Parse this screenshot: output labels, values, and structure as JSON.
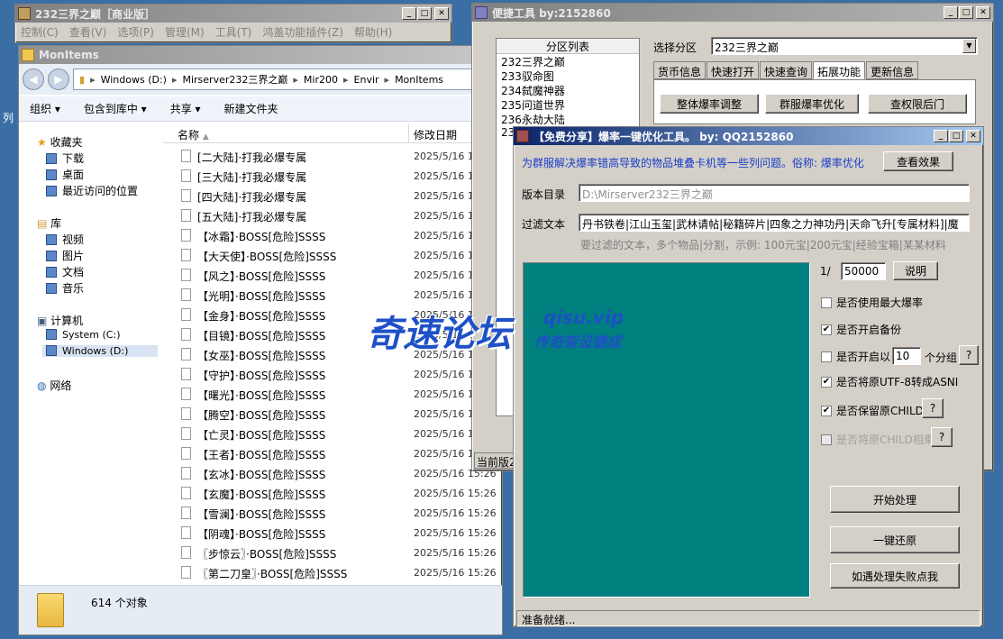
{
  "colors": {
    "desktop": "#3a6ea5",
    "teal": "#007f7f",
    "blue_text": "#1a3dc8"
  },
  "window1": {
    "title": "232三界之巅［商业版］",
    "menu": [
      "控制(C)",
      "查看(V)",
      "选项(P)",
      "管理(M)",
      "工具(T)",
      "鸿盖功能插件(Z)",
      "帮助(H)"
    ]
  },
  "explorer": {
    "title": "MonItems",
    "address": [
      "Windows (D:)",
      "Mirserver232三界之巅",
      "Mir200",
      "Envir",
      "MonItems"
    ],
    "toolbar": [
      "组织 ▾",
      "包含到库中 ▾",
      "共享 ▾",
      "新建文件夹"
    ],
    "nav": {
      "favorites": "收藏夹",
      "fav_items": [
        "下载",
        "桌面",
        "最近访问的位置"
      ],
      "libraries": "库",
      "lib_items": [
        "视频",
        "图片",
        "文档",
        "音乐"
      ],
      "computer": "计算机",
      "drives": [
        "System (C:)",
        "Windows (D:)"
      ],
      "network": "网络"
    },
    "columns": {
      "name": "名称",
      "date": "修改日期"
    },
    "files": [
      {
        "name": "[二大陆]·打我必爆专属",
        "date": "2025/5/16 1"
      },
      {
        "name": "[三大陆]·打我必爆专属",
        "date": "2025/5/16 1"
      },
      {
        "name": "[四大陆]·打我必爆专属",
        "date": "2025/5/16 1"
      },
      {
        "name": "[五大陆]·打我必爆专属",
        "date": "2025/5/16 1"
      },
      {
        "name": "【冰霜】·BOSS[危险]SSSS",
        "date": "2025/5/16 1"
      },
      {
        "name": "【大天使】·BOSS[危险]SSSS",
        "date": "2025/5/16 1"
      },
      {
        "name": "【风之】·BOSS[危险]SSSS",
        "date": "2025/5/16 1"
      },
      {
        "name": "【光明】·BOSS[危险]SSSS",
        "date": "2025/5/16 1"
      },
      {
        "name": "【金身】·BOSS[危险]SSSS",
        "date": "2025/5/16 1"
      },
      {
        "name": "【目镜】·BOSS[危险]SSSS",
        "date": "2025/5/16 1"
      },
      {
        "name": "【女巫】·BOSS[危险]SSSS",
        "date": "2025/5/16 1"
      },
      {
        "name": "【守护】·BOSS[危险]SSSS",
        "date": "2025/5/16 1"
      },
      {
        "name": "【曙光】·BOSS[危险]SSSS",
        "date": "2025/5/16 1"
      },
      {
        "name": "【腾空】·BOSS[危险]SSSS",
        "date": "2025/5/16 1"
      },
      {
        "name": "【亡灵】·BOSS[危险]SSSS",
        "date": "2025/5/16 1"
      },
      {
        "name": "【王者】·BOSS[危险]SSSS",
        "date": "2025/5/16 1"
      },
      {
        "name": "【玄冰】·BOSS[危险]SSSS",
        "date": "2025/5/16 15:26"
      },
      {
        "name": "【玄魔】·BOSS[危险]SSSS",
        "date": "2025/5/16 15:26"
      },
      {
        "name": "【雪澜】·BOSS[危险]SSSS",
        "date": "2025/5/16 15:26"
      },
      {
        "name": "【阴魂】·BOSS[危险]SSSS",
        "date": "2025/5/16 15:26"
      },
      {
        "name": "〖步惊云〗·BOSS[危险]SSSS",
        "date": "2025/5/16 15:26"
      },
      {
        "name": "〖第二刀皇〗·BOSS[危险]SSSS",
        "date": "2025/5/16 15:26"
      }
    ],
    "status": "614 个对象"
  },
  "quick": {
    "title": "便捷工具  by:2152860",
    "list_header": "分区列表",
    "list": [
      "232三界之巅",
      "233驭命图",
      "234弑魔神器",
      "235问道世界",
      "236永劫大陆",
      "23"
    ],
    "select_label": "选择分区",
    "select_value": "232三界之巅",
    "tabs": [
      "货币信息",
      "快速打开",
      "快速查询",
      "拓展功能",
      "更新信息"
    ],
    "buttons": [
      "整体爆率调整",
      "群服爆率优化",
      "查权限后门"
    ],
    "status_cut": "当前版2"
  },
  "dialog": {
    "title": "【免费分享】爆率一键优化工具。   by: QQ2152860",
    "intro": "为群服解决爆率错高导致的物品堆叠卡机等一些列问题。俗称: 爆率优化",
    "view_btn": "查看效果",
    "dir_label": "版本目录",
    "dir_value": "D:\\Mirserver232三界之巅",
    "filter_label": "过滤文本",
    "filter_value": "丹书铁卷|江山玉玺|武林请帖|秘籍碎片|四象之力神功丹|天命飞升[专属材料]|魔",
    "filter_hint": "要过滤的文本，多个物品|分割，示例: 100元宝|200元宝|经验宝箱|某某材料",
    "ratio_prefix": "1/",
    "ratio_value": "50000",
    "explain_btn": "说明",
    "opt_max": "是否使用最大爆率",
    "opt_backup": "是否开启备份",
    "opt_group_pre": "是否开启以",
    "opt_group_value": "10",
    "opt_group_post": "个分组",
    "opt_utf": "是否将原UTF-8转成ASNI",
    "opt_child": "是否保留原CHILD",
    "opt_child_merge": "是否将原CHILD相乘",
    "help": "?",
    "start_btn": "开始处理",
    "restore_btn": "一键还原",
    "fail_btn": "如遇处理失败点我",
    "status": "准备就绪..."
  },
  "watermark": {
    "main": "奇速论坛",
    "site": "qisu.vip",
    "sub": "传奇架设德成"
  },
  "desktop_edge": "列"
}
